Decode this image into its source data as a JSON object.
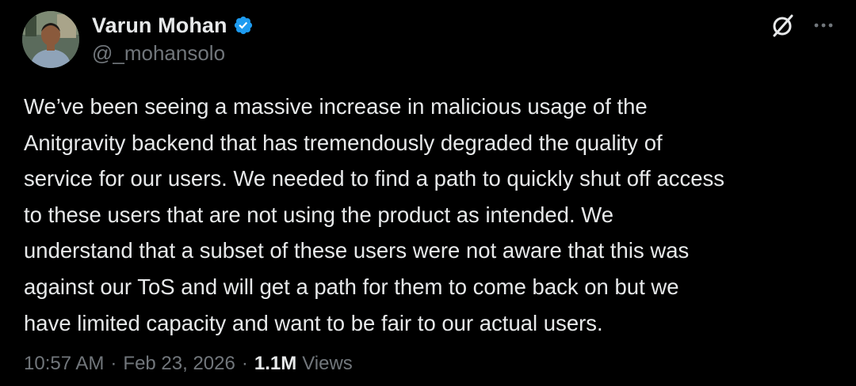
{
  "author": {
    "display_name": "Varun Mohan",
    "handle": "@_mohansolo",
    "verified": true,
    "verified_icon": "verified-badge-icon",
    "avatar_icon": "avatar"
  },
  "actions": {
    "grok_icon": "grok-icon",
    "more_icon": "more-options-icon"
  },
  "tweet": {
    "text": "We’ve been seeing a massive increase in malicious usage of the\nAnitgravity backend that has tremendously degraded the quality of\nservice for our users. We needed to find a path to quickly shut off access\nto these users that are not using the product as intended. We\nunderstand that a subset of these users were not aware that this was\nagainst our ToS and will get a path for them to come back on but we\nhave limited capacity and want to be fair to our actual users."
  },
  "meta": {
    "time": "10:57 AM",
    "separator": "·",
    "date": "Feb 23, 2026",
    "views_count": "1.1M",
    "views_label": "Views"
  },
  "colors": {
    "background": "#000000",
    "primary_text": "#e7e9ea",
    "secondary_text": "#71767b",
    "verified_blue": "#1d9bf0"
  }
}
